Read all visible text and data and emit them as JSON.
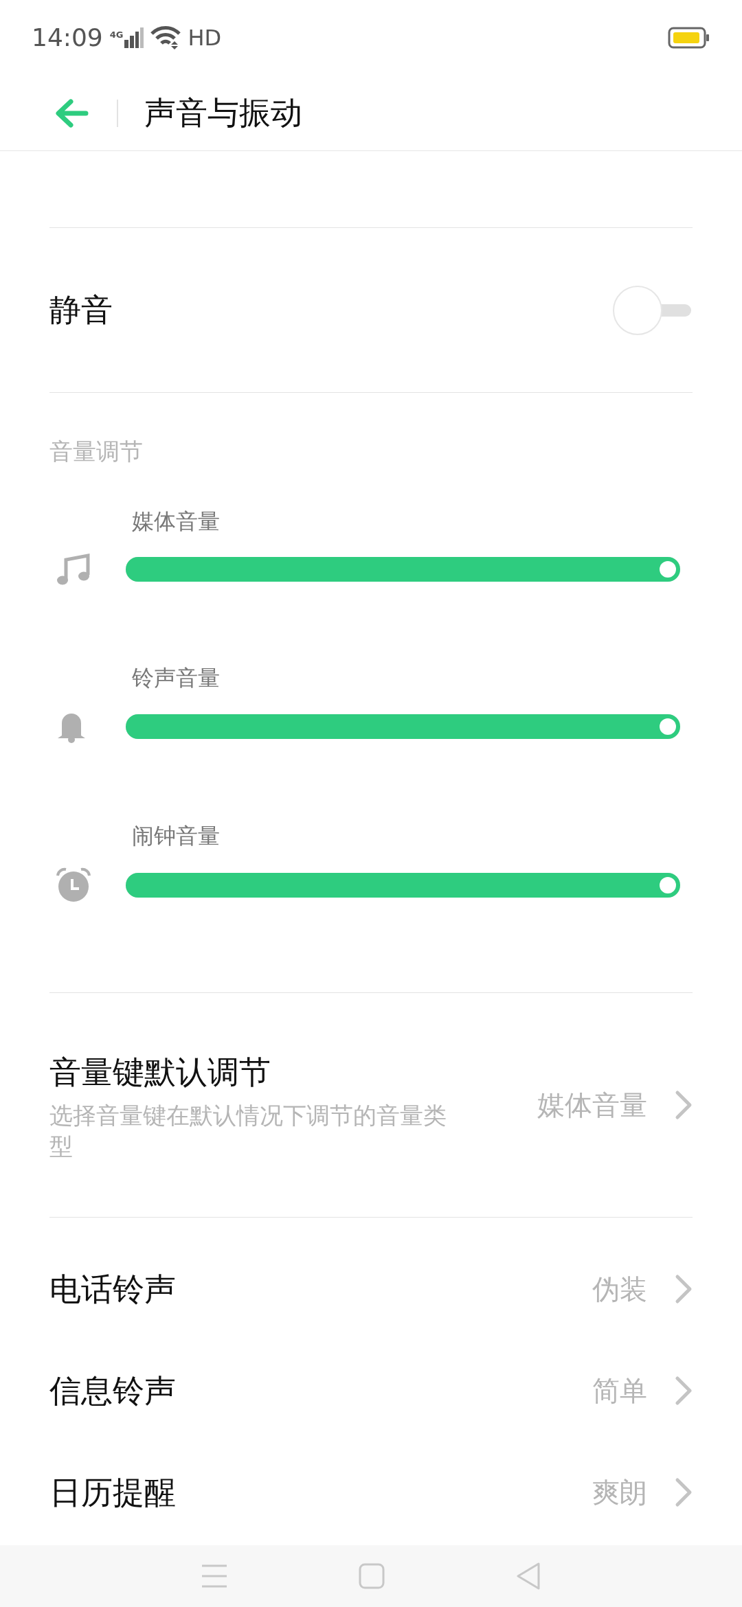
{
  "status_bar": {
    "time": "14:09",
    "network": "4G",
    "wifi_label": "HD"
  },
  "header": {
    "title": "声音与振动"
  },
  "toggles": [
    {
      "label": "静音",
      "on": false
    }
  ],
  "volume_section": {
    "title": "音量调节",
    "sliders": [
      {
        "kind": "media",
        "label": "媒体音量",
        "level": 1.0
      },
      {
        "kind": "ring",
        "label": "铃声音量",
        "level": 1.0
      },
      {
        "kind": "alarm",
        "label": "闹钟音量",
        "level": 1.0
      }
    ]
  },
  "volume_key": {
    "title": "音量键默认调节",
    "description": "选择音量键在默认情况下调节的音量类型",
    "value": "媒体音量"
  },
  "ringtones": [
    {
      "label": "电话铃声",
      "value": "伪装"
    },
    {
      "label": "信息铃声",
      "value": "简单"
    },
    {
      "label": "日历提醒",
      "value": "爽朗"
    }
  ]
}
